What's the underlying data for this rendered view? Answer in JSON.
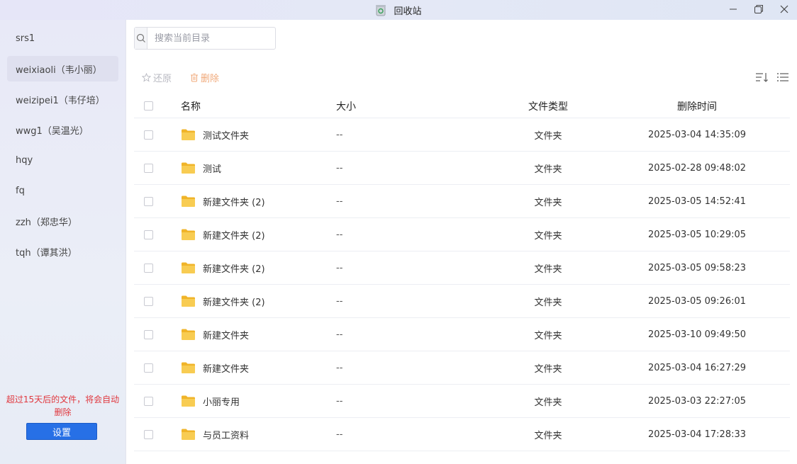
{
  "window": {
    "title": "回收站",
    "icon": "recycle-bin-icon",
    "controls": [
      "minimize-icon",
      "maximize-icon",
      "close-icon"
    ]
  },
  "sidebar": {
    "items": [
      {
        "label": "srs1",
        "active": false
      },
      {
        "label": "weixiaoli（韦小丽）",
        "active": true
      },
      {
        "label": "weizipei1（韦仔培）",
        "active": false
      },
      {
        "label": "wwg1（吴温光）",
        "active": false
      },
      {
        "label": "hqy",
        "active": false
      },
      {
        "label": "fq",
        "active": false
      },
      {
        "label": "zzh（郑忠华）",
        "active": false
      },
      {
        "label": "tqh（谭其洪）",
        "active": false
      }
    ],
    "notice": "超过15天后的文件，将会自动删除",
    "settings_label": "设置"
  },
  "search": {
    "placeholder": "搜索当前目录",
    "value": ""
  },
  "actions": {
    "restore_label": "还原",
    "delete_label": "删除"
  },
  "colors": {
    "accent": "#2770e6",
    "notice": "#e0383e",
    "folder": "#f6c443",
    "delete": "#f0a97a"
  },
  "table": {
    "headers": {
      "name": "名称",
      "size": "大小",
      "type": "文件类型",
      "time": "删除时间"
    },
    "rows": [
      {
        "name": "测试文件夹",
        "size": "--",
        "type": "文件夹",
        "time": "2025-03-04 14:35:09"
      },
      {
        "name": "测试",
        "size": "--",
        "type": "文件夹",
        "time": "2025-02-28 09:48:02"
      },
      {
        "name": "新建文件夹 (2)",
        "size": "--",
        "type": "文件夹",
        "time": "2025-03-05 14:52:41"
      },
      {
        "name": "新建文件夹 (2)",
        "size": "--",
        "type": "文件夹",
        "time": "2025-03-05 10:29:05"
      },
      {
        "name": "新建文件夹 (2)",
        "size": "--",
        "type": "文件夹",
        "time": "2025-03-05 09:58:23"
      },
      {
        "name": "新建文件夹 (2)",
        "size": "--",
        "type": "文件夹",
        "time": "2025-03-05 09:26:01"
      },
      {
        "name": "新建文件夹",
        "size": "--",
        "type": "文件夹",
        "time": "2025-03-10 09:49:50"
      },
      {
        "name": "新建文件夹",
        "size": "--",
        "type": "文件夹",
        "time": "2025-03-04 16:27:29"
      },
      {
        "name": "小丽专用",
        "size": "--",
        "type": "文件夹",
        "time": "2025-03-03 22:27:05"
      },
      {
        "name": "与员工资料",
        "size": "--",
        "type": "文件夹",
        "time": "2025-03-04 17:28:33"
      }
    ]
  }
}
